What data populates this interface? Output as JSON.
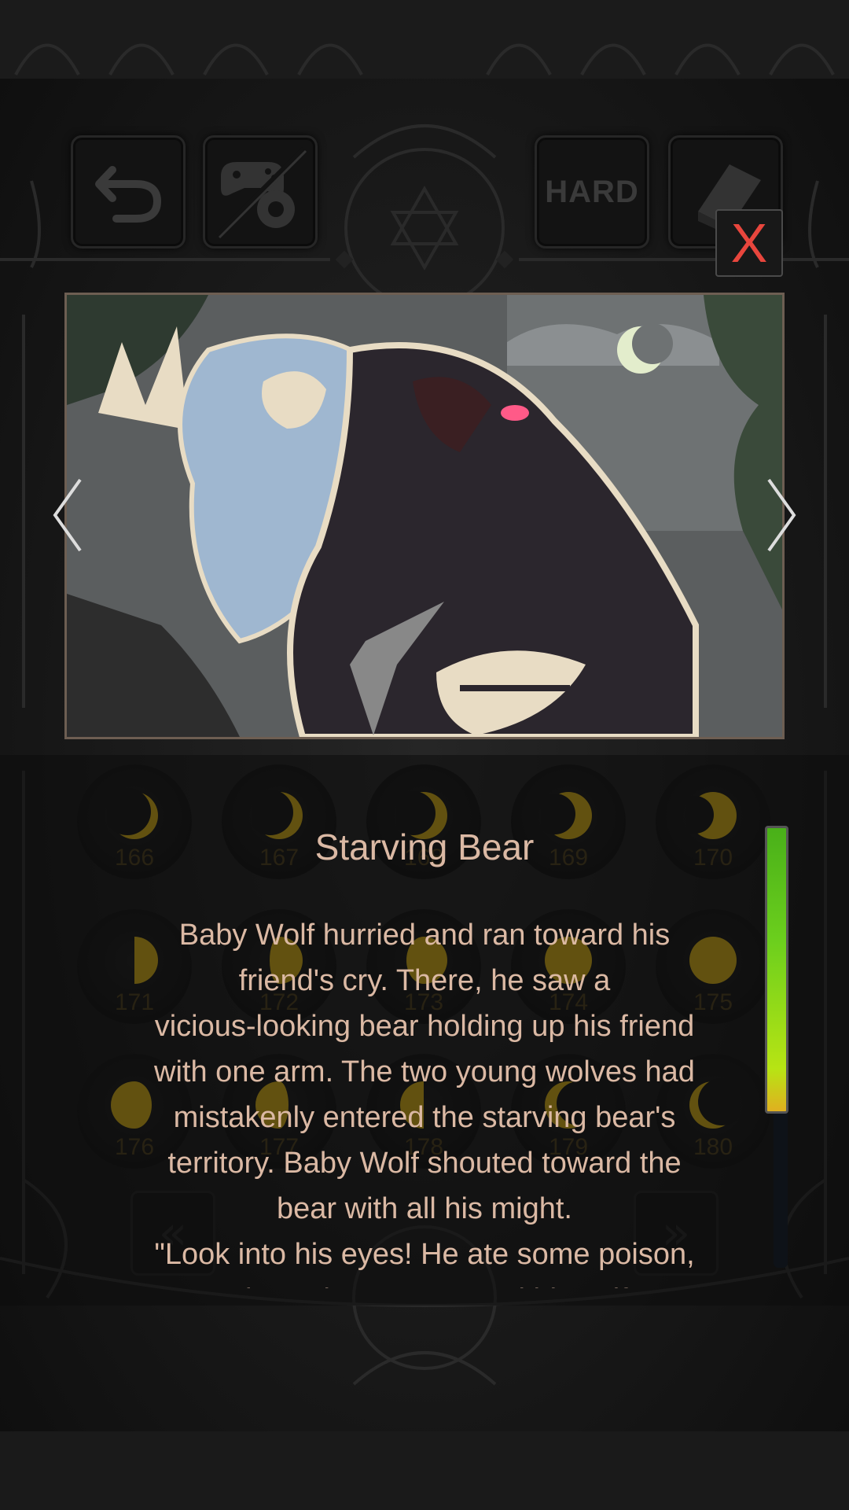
{
  "toolbar": {
    "back_icon": "undo-arrow-icon",
    "settings_icon": "gamepad-gear-icon",
    "difficulty_label": "HARD",
    "book_icon": "book-icon"
  },
  "dialog": {
    "close_label": "X",
    "prev_icon": "chevron-left-icon",
    "next_icon": "chevron-right-icon",
    "title": "Starving Bear",
    "story_lines": [
      "Baby Wolf hurried and ran toward his",
      "friend's cry. There, he saw a",
      "vicious-looking bear holding up his friend",
      "with one arm. The two young wolves had",
      "mistakenly entered the starving bear's",
      "territory. Baby Wolf shouted toward the",
      "bear with all his might.",
      "\"Look into his eyes! He ate some poison,",
      "and now he can't control himself!\""
    ],
    "scroll_position": 0.0
  },
  "chapter_grid": {
    "rows": [
      [
        "166",
        "167",
        "168",
        "169",
        "170"
      ],
      [
        "171",
        "172",
        "173",
        "174",
        "175"
      ],
      [
        "176",
        "177",
        "178",
        "179",
        "180"
      ]
    ],
    "prev_page_label": "«",
    "next_page_label": "»"
  },
  "colors": {
    "close_x": "#e8463d",
    "story_text": "#dbb9a4",
    "moon": "#c9a414",
    "scroll_thumb": "#6ccf1d"
  }
}
